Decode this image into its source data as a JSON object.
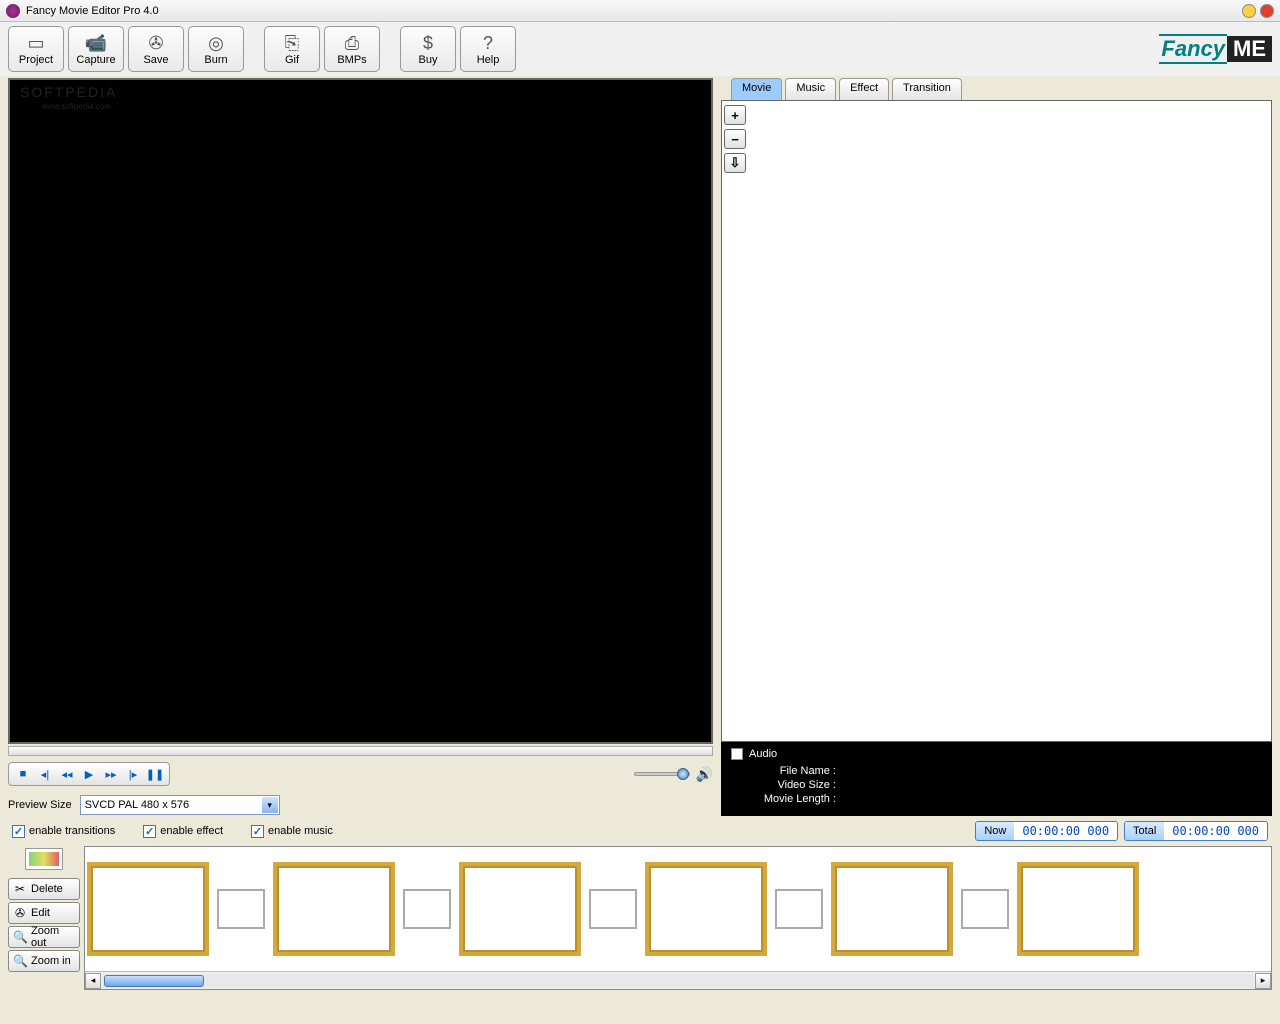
{
  "window": {
    "title": "Fancy Movie Editor Pro 4.0"
  },
  "watermark": {
    "line1": "SOFTPEDIA",
    "line2": "www.softpedia.com"
  },
  "toolbar": {
    "project": "Project",
    "capture": "Capture",
    "save": "Save",
    "burn": "Burn",
    "gif": "Gif",
    "bmps": "BMPs",
    "buy": "Buy",
    "help": "Help"
  },
  "brand": {
    "a": "Fancy",
    "b": "ME"
  },
  "tabs": {
    "movie": "Movie",
    "music": "Music",
    "effect": "Effect",
    "transition": "Transition"
  },
  "panelBtns": {
    "plus": "+",
    "minus": "−",
    "down": "⇩"
  },
  "previewSize": {
    "label": "Preview Size",
    "value": "SVCD PAL 480 x 576"
  },
  "info": {
    "audioLabel": "Audio",
    "fileName": "File Name :",
    "videoSize": "Video Size :",
    "movieLength": "Movie Length :"
  },
  "opts": {
    "transitions": "enable transitions",
    "effect": "enable effect",
    "music": "enable music"
  },
  "time": {
    "nowLabel": "Now",
    "nowValue": "00:00:00 000",
    "totalLabel": "Total",
    "totalValue": "00:00:00 000"
  },
  "sideBtns": {
    "delete": "Delete",
    "edit": "Edit",
    "zoomOut": "Zoom out",
    "zoomIn": "Zoom in"
  }
}
